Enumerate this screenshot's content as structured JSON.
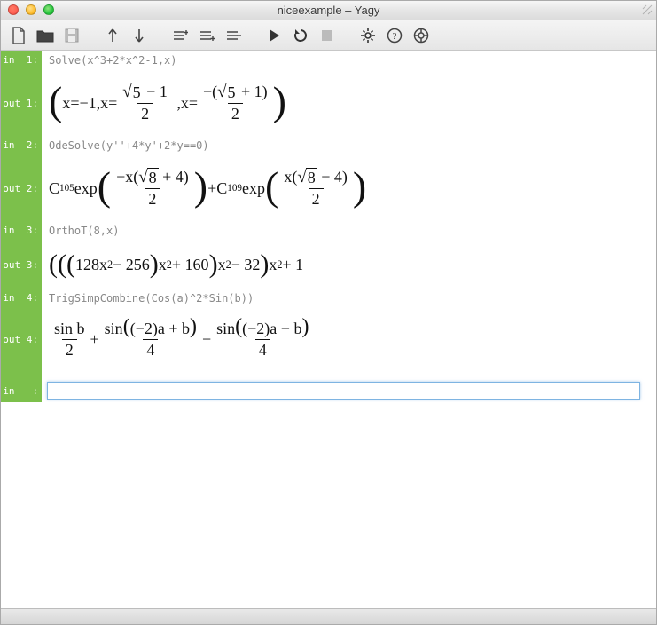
{
  "window": {
    "title": "niceexample – Yagy"
  },
  "toolbar": {
    "items": [
      "new-file-icon",
      "open-file-icon",
      "save-icon",
      "sep",
      "arrow-up-icon",
      "arrow-down-icon",
      "sep",
      "insert-above-icon",
      "insert-below-icon",
      "delete-cell-icon",
      "sep",
      "run-icon",
      "reload-icon",
      "stop-icon",
      "sep",
      "gear-icon",
      "help-icon",
      "lifering-icon"
    ]
  },
  "cells": [
    {
      "kind": "in",
      "label": "in  1:",
      "code": "Solve(x^3+2*x^2-1,x)"
    },
    {
      "kind": "out",
      "label": "out 1:",
      "math": "out1"
    },
    {
      "kind": "in",
      "label": "in  2:",
      "code": "OdeSolve(y''+4*y'+2*y==0)"
    },
    {
      "kind": "out",
      "label": "out 2:",
      "math": "out2"
    },
    {
      "kind": "in",
      "label": "in  3:",
      "code": "OrthoT(8,x)"
    },
    {
      "kind": "out",
      "label": "out 3:",
      "math": "out3"
    },
    {
      "kind": "in",
      "label": "in  4:",
      "code": "TrigSimpCombine(Cos(a)^2*Sin(b))"
    },
    {
      "kind": "out",
      "label": "out 4:",
      "math": "out4"
    },
    {
      "kind": "in-active",
      "label": "in   :",
      "code": ""
    }
  ],
  "math": {
    "out1": {
      "repr": "( x = -1, x = (√5 − 1)/2 , x = −(√5 + 1)/2 )",
      "parts": {
        "x": "x",
        "eq": " = ",
        "m1": "−1",
        "comma": ",",
        "sqrt5": "5",
        "minus": " − ",
        "plus": " + ",
        "one": "1",
        "two": "2",
        "neg": "−"
      }
    },
    "out2": {
      "repr": "C105 exp( −x(√8 + 4)/2 ) + C109 exp( x(√8 − 4)/2 )",
      "parts": {
        "C": "C",
        "s105": "105",
        "s109": "109",
        "exp": " exp",
        "minus_x": "−x",
        "x": "x",
        "sqrt8": "8",
        "p4": " + 4",
        "m4": " − 4",
        "two": "2",
        "plus": " + "
      }
    },
    "out3": {
      "repr": "(((128x^2 − 256)x^2 + 160)x^2 − 32)x^2 + 1",
      "parts": {
        "a": "128x",
        "sq": "2",
        "b": " − 256",
        "c": " + 160",
        "d": " − 32",
        "e": " + 1",
        "x": "x"
      }
    },
    "out4": {
      "repr": "sin b / 2 + sin((−2)a + b)/4 − sin((−2)a − b)/4",
      "parts": {
        "sinb": "sin b",
        "two": "2",
        "four": "4",
        "plus": " + ",
        "minus": " − ",
        "sin": "sin",
        "m2a": "(−2)a",
        "pb": " + b",
        "mb": " − b"
      }
    }
  }
}
